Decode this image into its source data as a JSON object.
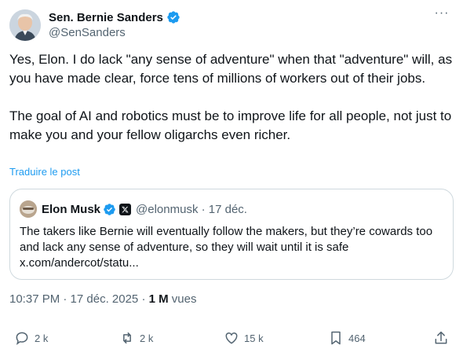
{
  "author": {
    "display_name": "Sen. Bernie Sanders",
    "handle": "@SenSanders"
  },
  "more_label": "···",
  "tweet": {
    "paragraph1": "Yes, Elon. I do lack \"any sense of adventure\" when that \"adventure\" will, as you have made clear, force tens of millions of workers out of their jobs.",
    "paragraph2": "The goal of AI and robotics must be to improve life for all people, not just to make you and your fellow oligarchs even richer."
  },
  "translate_label": "Traduire le post",
  "quote": {
    "display_name": "Elon Musk",
    "handle_date": "@elonmusk · 17 déc.",
    "text": "The takers like Bernie will eventually follow the makers, but they’re cowards too and lack any sense of adventure, so they will wait until it is safe x.com/andercot/statu..."
  },
  "meta": {
    "time_date": "10:37 PM · 17 déc. 2025 · ",
    "views_count": "1 M",
    "views_label": " vues"
  },
  "actions": {
    "replies": "2 k",
    "reposts": "2 k",
    "likes": "15 k",
    "bookmarks": "464"
  },
  "colors": {
    "verified_blue": "#1d9bf0",
    "secondary_text": "#536471",
    "primary_text": "#0f1419",
    "border": "#cfd9de"
  }
}
